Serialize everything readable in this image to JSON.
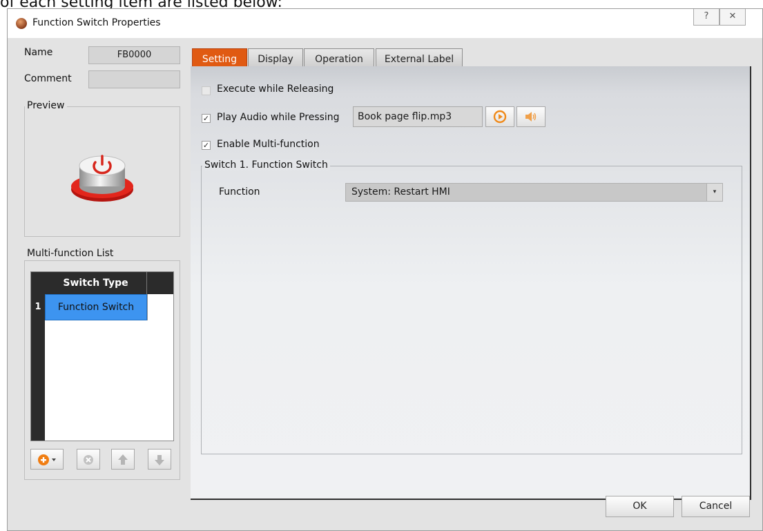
{
  "doc_snippet": "of each setting item are listed below:",
  "window": {
    "title": "Function Switch Properties",
    "help_glyph": "?",
    "close_glyph": "✕"
  },
  "left": {
    "name_label": "Name",
    "name_value": "FB0000",
    "comment_label": "Comment",
    "comment_value": "",
    "preview_legend": "Preview",
    "list_legend": "Multi-function List",
    "list_header": "Switch Type",
    "rows": [
      {
        "index": "1",
        "type": "Function Switch"
      }
    ]
  },
  "tabs": [
    {
      "label": "Setting",
      "active": true
    },
    {
      "label": "Display",
      "active": false
    },
    {
      "label": "Operation",
      "active": false
    },
    {
      "label": "External Label",
      "active": false
    }
  ],
  "setting": {
    "execute_release": {
      "label": "Execute while Releasing",
      "checked": false
    },
    "play_audio": {
      "label": "Play Audio while Pressing",
      "checked": true,
      "file": "Book page flip.mp3"
    },
    "multi_function": {
      "label": "Enable Multi-function",
      "checked": true
    },
    "switch_group_legend": "Switch 1. Function Switch",
    "function_label": "Function",
    "function_value": "System: Restart HMI"
  },
  "buttons": {
    "ok": "OK",
    "cancel": "Cancel"
  },
  "colors": {
    "active_tab": "#e05a12",
    "list_selection": "#3d94f0",
    "play_icon": "#f08a1a"
  }
}
